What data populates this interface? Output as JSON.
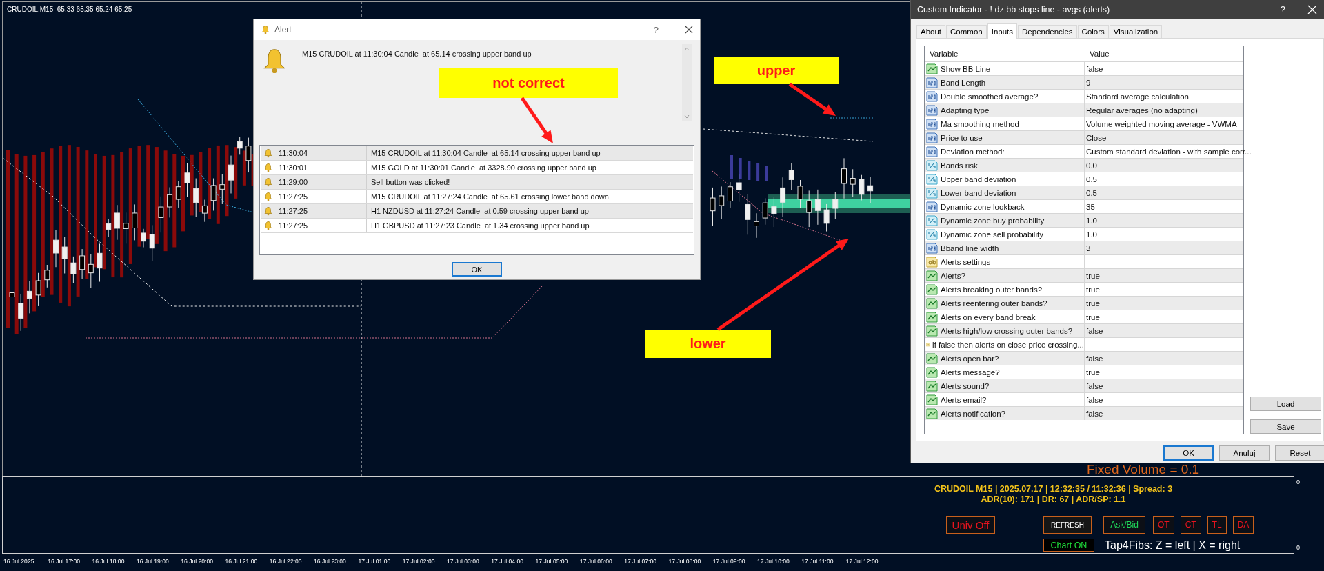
{
  "chart": {
    "symbol_info": "CRUDOIL,M15  65.33 65.35 65.24 65.25",
    "annotations": [
      {
        "text": "not correct"
      },
      {
        "text": "upper"
      },
      {
        "text": "lower"
      }
    ],
    "fixed_volume": "Fixed Volume = 0.1",
    "info_panel": {
      "status_line": "CRUDOIL M15 | 2025.07.17 | 12:32:35 / 11:32:36 | Spread: 3",
      "range_line": "ADR(10): 171 | DR: 67 | ADR/SP: 1.1",
      "buttons": [
        {
          "label": "Univ Off",
          "color": "#e8141e"
        },
        {
          "label": "REFRESH",
          "color": "#ffffff"
        },
        {
          "label": "Ask/Bid",
          "color": "#1fd65a"
        },
        {
          "label": "OT",
          "color": "#e8141e"
        },
        {
          "label": "CT",
          "color": "#e8141e"
        },
        {
          "label": "TL",
          "color": "#e8141e"
        },
        {
          "label": "DA",
          "color": "#e8141e"
        }
      ],
      "chart_toggle": "Chart ON",
      "hotkeys": "Tap4Fibs: Z = left | X = right"
    },
    "subpane_scale": [
      "0",
      "0"
    ],
    "time_axis": [
      "16 Jul 2025",
      "16 Jul 17:00",
      "16 Jul 18:00",
      "16 Jul 19:00",
      "16 Jul 20:00",
      "16 Jul 21:00",
      "16 Jul 22:00",
      "16 Jul 23:00",
      "17 Jul 01:00",
      "17 Jul 02:00",
      "17 Jul 03:00",
      "17 Jul 04:00",
      "17 Jul 05:00",
      "17 Jul 06:00",
      "17 Jul 07:00",
      "17 Jul 08:00",
      "17 Jul 09:00",
      "17 Jul 10:00",
      "17 Jul 11:00",
      "17 Jul 12:00"
    ]
  },
  "alert_dialog": {
    "title": "Alert",
    "help": "?",
    "message": "M15 CRUDOIL at 11:30:04 Candle  at 65.14 crossing upper band up",
    "log": [
      {
        "time": "11:30:04",
        "text": "M15 CRUDOIL at 11:30:04 Candle  at 65.14 crossing upper band up"
      },
      {
        "time": "11:30:01",
        "text": "M15 GOLD at 11:30:01 Candle  at 3328.90 crossing upper band up"
      },
      {
        "time": "11:29:00",
        "text": "Sell button was clicked!"
      },
      {
        "time": "11:27:25",
        "text": "M15 CRUDOIL at 11:27:24 Candle  at 65.61 crossing lower band down"
      },
      {
        "time": "11:27:25",
        "text": "H1 NZDUSD at 11:27:24 Candle  at 0.59 crossing upper band up"
      },
      {
        "time": "11:27:25",
        "text": "H1 GBPUSD at 11:27:23 Candle  at 1.34 crossing upper band up"
      }
    ],
    "ok_button": "OK"
  },
  "indicator_dialog": {
    "title": "Custom Indicator - ! dz bb stops line - avgs (alerts)",
    "help": "?",
    "tabs": [
      {
        "label": "About",
        "selected": false
      },
      {
        "label": "Common",
        "selected": false
      },
      {
        "label": "Inputs",
        "selected": true
      },
      {
        "label": "Dependencies",
        "selected": false
      },
      {
        "label": "Colors",
        "selected": false
      },
      {
        "label": "Visualization",
        "selected": false
      }
    ],
    "columns": [
      "Variable",
      "Value"
    ],
    "inputs": [
      {
        "kind": "bool",
        "name": "Show BB Line",
        "value": "false"
      },
      {
        "kind": "int",
        "name": "Band Length",
        "value": "9"
      },
      {
        "kind": "int",
        "name": "Double smoothed average?",
        "value": "Standard average calculation"
      },
      {
        "kind": "int",
        "name": "Adapting type",
        "value": "Regular averages (no adapting)"
      },
      {
        "kind": "int",
        "name": "Ma smoothing method",
        "value": "Volume weighted moving average - VWMA"
      },
      {
        "kind": "int",
        "name": "Price to use",
        "value": "Close"
      },
      {
        "kind": "int",
        "name": "Deviation method:",
        "value": "Custom standard deviation - with sample corr..."
      },
      {
        "kind": "double",
        "name": "Bands risk",
        "value": "0.0"
      },
      {
        "kind": "double",
        "name": "Upper band deviation",
        "value": "0.5"
      },
      {
        "kind": "double",
        "name": "Lower band deviation",
        "value": "0.5"
      },
      {
        "kind": "int",
        "name": "Dynamic zone lookback",
        "value": "35"
      },
      {
        "kind": "double",
        "name": "Dynamic zone buy probability",
        "value": "1.0"
      },
      {
        "kind": "double",
        "name": "Dynamic zone sell probability",
        "value": "1.0"
      },
      {
        "kind": "int",
        "name": "Bband line width",
        "value": "3"
      },
      {
        "kind": "string",
        "name": "Alerts settings"
      },
      {
        "kind": "bool",
        "name": "Alerts?",
        "value": "true"
      },
      {
        "kind": "bool",
        "name": "Alerts breaking outer bands?",
        "value": "true"
      },
      {
        "kind": "bool",
        "name": "Alerts reentering outer bands?",
        "value": "true"
      },
      {
        "kind": "bool",
        "name": "Alerts on every band break",
        "value": "true"
      },
      {
        "kind": "bool",
        "name": "Alerts high/low crossing outer bands?",
        "value": "false"
      },
      {
        "kind": "string",
        "name": "if false then alerts on close price crossing..."
      },
      {
        "kind": "bool",
        "name": "Alerts open bar?",
        "value": "false"
      },
      {
        "kind": "bool",
        "name": "Alerts message?",
        "value": "true"
      },
      {
        "kind": "bool",
        "name": "Alerts sound?",
        "value": "false"
      },
      {
        "kind": "bool",
        "name": "Alerts email?",
        "value": "false"
      },
      {
        "kind": "bool",
        "name": "Alerts notification?",
        "value": "false"
      }
    ],
    "side_buttons": [
      "Load",
      "Save"
    ],
    "footer_buttons": [
      "OK",
      "Anuluj",
      "Reset"
    ]
  }
}
